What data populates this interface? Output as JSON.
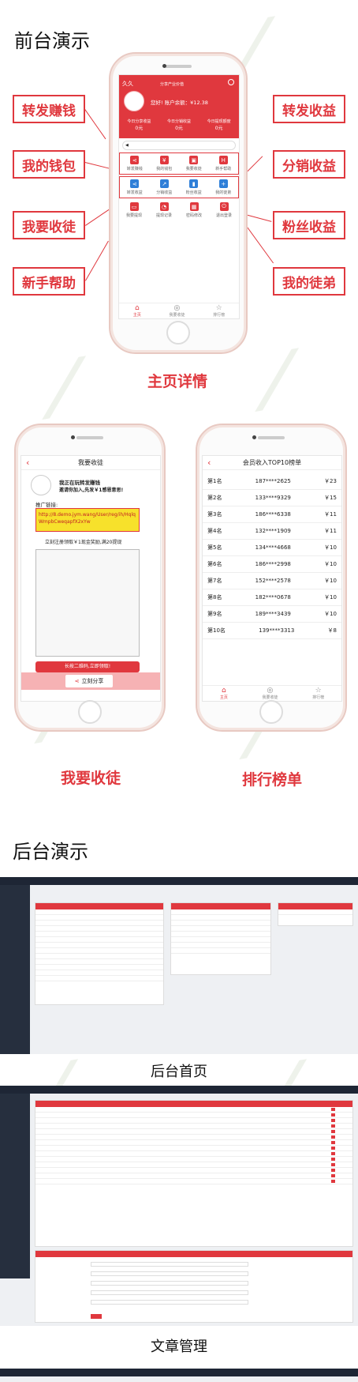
{
  "frontend": {
    "title": "前台演示",
    "left_labels": [
      "转发赚钱",
      "我的钱包",
      "我要收徒",
      "新手帮助"
    ],
    "right_labels": [
      "转发收益",
      "分销收益",
      "粉丝收益",
      "我的徒弟"
    ],
    "caption": "主页详情"
  },
  "home_screen": {
    "app_name": "久久",
    "header_small": "分享产业价值",
    "greeting": "您好! 账户余额：¥12.38",
    "stats": [
      {
        "label": "今日分享收益",
        "value": "0元"
      },
      {
        "label": "今日分销收益",
        "value": "0元"
      },
      {
        "label": "今日提现额度",
        "value": "0元"
      }
    ],
    "grid1": [
      {
        "label": "转发赚钱",
        "icon": "share-icon",
        "color": "#e0383e"
      },
      {
        "label": "我的钱包",
        "icon": "yen-icon",
        "color": "#e0383e"
      },
      {
        "label": "我要收徒",
        "icon": "car-icon",
        "color": "#e0383e"
      },
      {
        "label": "新手帮助",
        "icon": "help-icon",
        "color": "#e0383e"
      }
    ],
    "grid2": [
      {
        "label": "转发收益",
        "icon": "share-icon",
        "color": "#2f7fd8"
      },
      {
        "label": "分销收益",
        "icon": "chart-icon",
        "color": "#2f7fd8"
      },
      {
        "label": "粉丝收益",
        "icon": "bar-icon",
        "color": "#2f7fd8"
      },
      {
        "label": "我的徒弟",
        "icon": "user-add-icon",
        "color": "#2f7fd8"
      }
    ],
    "grid3": [
      {
        "label": "我要提现",
        "icon": "card-icon",
        "color": "#e0383e"
      },
      {
        "label": "提现记录",
        "icon": "pie-icon",
        "color": "#e0383e"
      },
      {
        "label": "密码修改",
        "icon": "lock-icon",
        "color": "#e0383e"
      },
      {
        "label": "退出登录",
        "icon": "power-icon",
        "color": "#e0383e"
      }
    ],
    "tabs": [
      "主页",
      "我要收徒",
      "排行榜"
    ]
  },
  "recruit_screen": {
    "title": "我要收徒",
    "line1": "我正在玩转发赚钱",
    "line2": "邀请你加入,先发￥1感恩意思!",
    "link_label": "推广链接:",
    "link_text": "http://8.demo.jym.wang/User/reg/ih/HqlqWmpbCweqapfX2xYw",
    "promo": "立刻注册领取￥1现金奖励,满20提现",
    "long_press": "长按二维码,立即领取!",
    "share_button": "立刻分享",
    "caption": "我要收徒"
  },
  "ranking_screen": {
    "title": "会员收入TOP10榜单",
    "rows": [
      {
        "rank": "第1名",
        "phone": "187****2625",
        "amount": "￥23"
      },
      {
        "rank": "第2名",
        "phone": "133****9329",
        "amount": "￥15"
      },
      {
        "rank": "第3名",
        "phone": "186****6338",
        "amount": "￥11"
      },
      {
        "rank": "第4名",
        "phone": "132****1909",
        "amount": "￥11"
      },
      {
        "rank": "第5名",
        "phone": "134****4668",
        "amount": "￥10"
      },
      {
        "rank": "第6名",
        "phone": "186****2998",
        "amount": "￥10"
      },
      {
        "rank": "第7名",
        "phone": "152****2578",
        "amount": "￥10"
      },
      {
        "rank": "第8名",
        "phone": "182****0678",
        "amount": "￥10"
      },
      {
        "rank": "第9名",
        "phone": "189****3439",
        "amount": "￥10"
      },
      {
        "rank": "第10名",
        "phone": "139****3313",
        "amount": "￥8"
      }
    ],
    "tabs": [
      "主页",
      "我要收徒",
      "排行榜"
    ],
    "caption": "排行榜单"
  },
  "backend": {
    "title": "后台演示",
    "dashboard_caption": "后台首页",
    "article_caption": "文章管理"
  }
}
